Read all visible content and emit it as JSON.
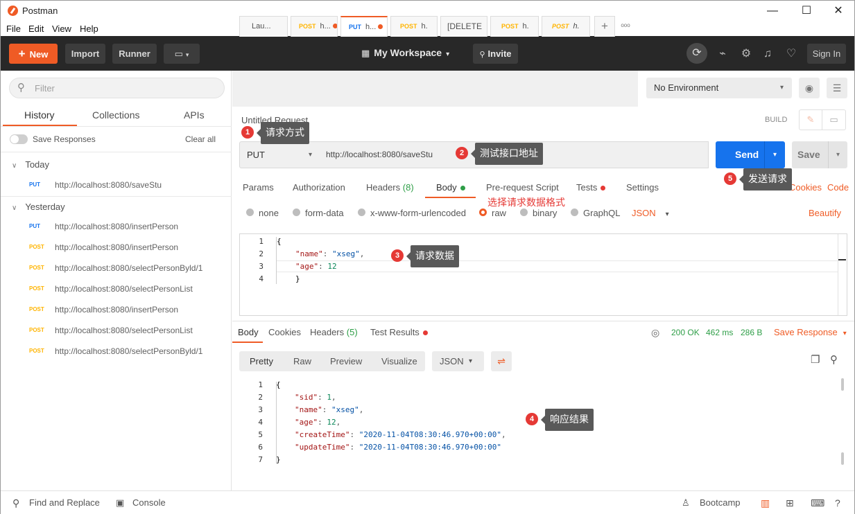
{
  "window": {
    "title": "Postman",
    "minimize": "—",
    "maximize": "☐",
    "close": "✕"
  },
  "menu": [
    "File",
    "Edit",
    "View",
    "Help"
  ],
  "header": {
    "new_label": "New",
    "import_label": "Import",
    "runner_label": "Runner",
    "workspace_label": "My Workspace",
    "invite_label": "Invite",
    "signin_label": "Sign In"
  },
  "sidebar": {
    "filter_placeholder": "Filter",
    "tabs": [
      "History",
      "Collections",
      "APIs"
    ],
    "save_responses_label": "Save Responses",
    "clear_all_label": "Clear all",
    "sections": [
      {
        "title": "Today",
        "items": [
          {
            "method": "PUT",
            "url": "http://localhost:8080/saveStu"
          }
        ]
      },
      {
        "title": "Yesterday",
        "items": [
          {
            "method": "PUT",
            "url": "http://localhost:8080/insertPerson"
          },
          {
            "method": "POST",
            "url": "http://localhost:8080/insertPerson"
          },
          {
            "method": "POST",
            "url": "http://localhost:8080/selectPersonByld/1"
          },
          {
            "method": "POST",
            "url": "http://localhost:8080/selectPersonList"
          },
          {
            "method": "POST",
            "url": "http://localhost:8080/insertPerson"
          },
          {
            "method": "POST",
            "url": "http://localhost:8080/selectPersonList"
          },
          {
            "method": "POST",
            "url": "http://localhost:8080/selectPersonByld/1"
          }
        ]
      }
    ]
  },
  "request_tabs": [
    {
      "label": "Lau..."
    },
    {
      "method": "POST",
      "label": "h..."
    },
    {
      "method": "PUT",
      "label": "h..."
    },
    {
      "method": "POST",
      "label": "h."
    },
    {
      "label": "[DELETE"
    },
    {
      "method": "POST",
      "label": "h."
    },
    {
      "method": "POST",
      "label": "h."
    }
  ],
  "tab_add": "+",
  "tab_more": "ooo",
  "environment": {
    "selected": "No Environment"
  },
  "request": {
    "name": "Untitled Request",
    "build_label": "BUILD",
    "method": "PUT",
    "url": "http://localhost:8080/saveStu",
    "send_label": "Send",
    "save_label": "Save",
    "cookies_label": "Cookies",
    "code_label": "Code",
    "tabs": {
      "params": "Params",
      "authorization": "Authorization",
      "headers": "Headers",
      "headers_count": "(8)",
      "body": "Body",
      "prerequest": "Pre-request Script",
      "tests": "Tests",
      "settings": "Settings"
    },
    "body_types": [
      "none",
      "form-data",
      "x-www-form-urlencoded",
      "raw",
      "binary",
      "GraphQL"
    ],
    "body_format": "JSON",
    "beautify_label": "Beautify",
    "body_lines": [
      "{",
      "\"name\": \"xseg\",",
      "\"age\": 12",
      "}"
    ]
  },
  "response": {
    "tabs": {
      "body": "Body",
      "cookies": "Cookies",
      "headers": "Headers",
      "headers_count": "(5)",
      "tests": "Test Results"
    },
    "status": "200 OK",
    "time": "462 ms",
    "size": "286 B",
    "save_label": "Save Response",
    "views": [
      "Pretty",
      "Raw",
      "Preview",
      "Visualize"
    ],
    "format": "JSON",
    "lines": [
      "{",
      "\"sid\": 1,",
      "\"name\": \"xseg\",",
      "\"age\": 12,",
      "\"createTime\": \"2020-11-04T08:30:46.970+00:00\",",
      "\"updateTime\": \"2020-11-04T08:30:46.970+00:00\"",
      "}"
    ]
  },
  "statusbar": {
    "find_replace": "Find and Replace",
    "console": "Console",
    "bootcamp": "Bootcamp"
  },
  "annotations": [
    {
      "num": "1",
      "text": "请求方式"
    },
    {
      "num": "2",
      "text": "测试接口地址"
    },
    {
      "num": "3",
      "text": "请求数据"
    },
    {
      "num": "4",
      "text": "响应结果"
    },
    {
      "num": "5",
      "text": "发送请求"
    }
  ],
  "annotation_body_format": "选择请求数据格式",
  "colors": {
    "accent": "#ef5b25",
    "send": "#1673ed",
    "header": "#282828",
    "post": "#ffb400",
    "put": "#1673ed",
    "ok": "#2e9e47",
    "annotation": "#e53935"
  }
}
